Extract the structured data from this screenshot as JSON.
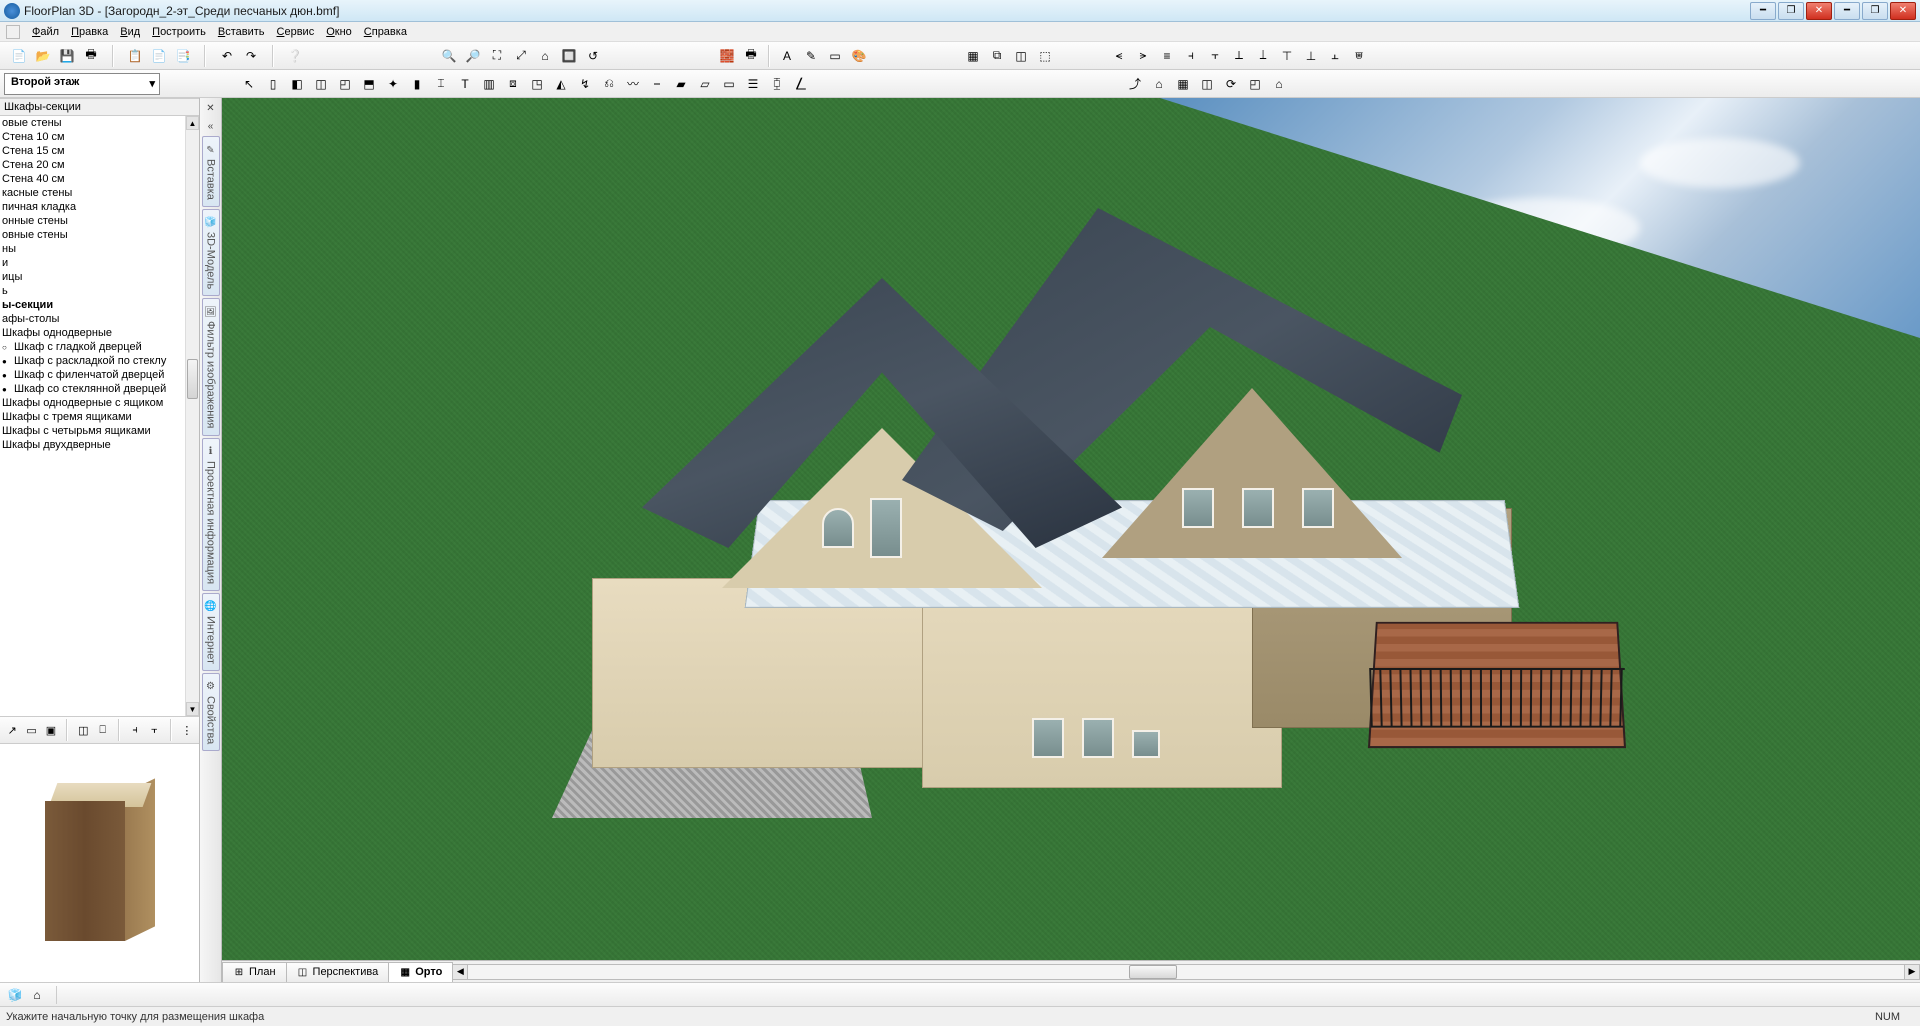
{
  "titlebar": {
    "title": "FloorPlan 3D - [Загородн_2-эт_Среди песчаных дюн.bmf]"
  },
  "menu": {
    "items": [
      "Файл",
      "Правка",
      "Вид",
      "Построить",
      "Вставить",
      "Сервис",
      "Окно",
      "Справка"
    ]
  },
  "floor_selector": {
    "value": "Второй этаж"
  },
  "sidebar": {
    "title": "Шкафы-секции",
    "items": [
      {
        "label": "овые стены"
      },
      {
        "label": "Стена 10 см"
      },
      {
        "label": "Стена 15 см"
      },
      {
        "label": "Стена 20 см"
      },
      {
        "label": "Стена 40 см"
      },
      {
        "label": "касные стены"
      },
      {
        "label": "пичная кладка"
      },
      {
        "label": "онные стены"
      },
      {
        "label": "овные стены"
      },
      {
        "label": "ны"
      },
      {
        "label": "и"
      },
      {
        "label": "ицы"
      },
      {
        "label": "ь"
      },
      {
        "label": "ы-секции",
        "bold": true
      },
      {
        "label": "афы-столы"
      },
      {
        "label": "Шкафы однодверные"
      },
      {
        "label": "Шкаф с гладкой дверцей",
        "sub": true,
        "filled": false
      },
      {
        "label": "Шкаф с раскладкой по стеклу",
        "sub": true,
        "filled": true
      },
      {
        "label": "Шкаф с филенчатой дверцей",
        "sub": true,
        "filled": true
      },
      {
        "label": "Шкаф со стеклянной дверцей",
        "sub": true,
        "filled": true
      },
      {
        "label": "Шкафы однодверные с ящиком"
      },
      {
        "label": "Шкафы с тремя ящиками"
      },
      {
        "label": "Шкафы с четырьмя ящиками"
      },
      {
        "label": "Шкафы двухдверные"
      }
    ]
  },
  "vtabs": {
    "items": [
      "Вставка",
      "3D-Модель",
      "Фильтр изображения",
      "Проектная информация",
      "Интернет",
      "Свойства"
    ]
  },
  "view_tabs": {
    "items": [
      {
        "label": "План"
      },
      {
        "label": "Перспектива"
      },
      {
        "label": "Орто",
        "active": true
      }
    ]
  },
  "statusbar": {
    "hint": "Укажите начальную точку для размещения шкафа",
    "num": "NUM"
  },
  "toolbar_icons": {
    "row1_a": [
      "📄",
      "📂",
      "💾",
      "🖶"
    ],
    "row1_b": [
      "📋",
      "📄",
      "📑"
    ],
    "row1_c": [
      "↶",
      "↷"
    ],
    "row1_d": [
      "❔"
    ],
    "row1_zoom": [
      "🔍",
      "🔎",
      "⛶",
      "⤢",
      "⌂",
      "🔲",
      "↺"
    ],
    "row1_mid": [
      "🧱",
      "🖶",
      "|",
      "A",
      "✎",
      "▭",
      "🎨"
    ],
    "row1_grid": [
      "▦",
      "⧉",
      "◫",
      "⬚"
    ],
    "row1_align": [
      "⪪",
      "⪫",
      "≡",
      "⫞",
      "⫟",
      "⟂",
      "⟘",
      "⊤",
      "⊥",
      "⫠",
      "⩐"
    ],
    "row2_tools": [
      "↖",
      "▯",
      "◧",
      "◫",
      "◰",
      "⬒",
      "✦",
      "▮",
      "⌶",
      "T",
      "▥",
      "⧈",
      "◳",
      "◭",
      "↯",
      "⎌",
      "〰",
      "⎯",
      "▰",
      "▱",
      "▭",
      "☰",
      "⧮",
      "⎳"
    ],
    "row2_right": [
      "⤴",
      "⌂",
      "▦",
      "◫",
      "⟳",
      "◰",
      "⌂"
    ],
    "side_tb": [
      "↗",
      "▭",
      "▣",
      "|",
      "◫",
      "⎕",
      "|",
      "⫞",
      "⫟",
      "|",
      "⋮"
    ]
  }
}
